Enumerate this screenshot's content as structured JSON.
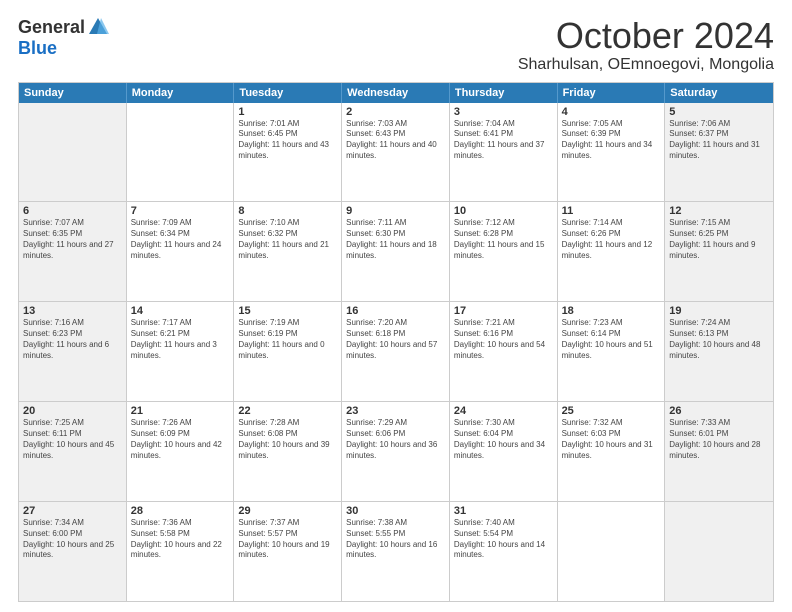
{
  "logo": {
    "general": "General",
    "blue": "Blue"
  },
  "header": {
    "month": "October 2024",
    "location": "Sharhulsan, OEmnoegovi, Mongolia"
  },
  "days": [
    "Sunday",
    "Monday",
    "Tuesday",
    "Wednesday",
    "Thursday",
    "Friday",
    "Saturday"
  ],
  "rows": [
    [
      {
        "day": "",
        "text": ""
      },
      {
        "day": "",
        "text": ""
      },
      {
        "day": "1",
        "text": "Sunrise: 7:01 AM\nSunset: 6:45 PM\nDaylight: 11 hours and 43 minutes."
      },
      {
        "day": "2",
        "text": "Sunrise: 7:03 AM\nSunset: 6:43 PM\nDaylight: 11 hours and 40 minutes."
      },
      {
        "day": "3",
        "text": "Sunrise: 7:04 AM\nSunset: 6:41 PM\nDaylight: 11 hours and 37 minutes."
      },
      {
        "day": "4",
        "text": "Sunrise: 7:05 AM\nSunset: 6:39 PM\nDaylight: 11 hours and 34 minutes."
      },
      {
        "day": "5",
        "text": "Sunrise: 7:06 AM\nSunset: 6:37 PM\nDaylight: 11 hours and 31 minutes."
      }
    ],
    [
      {
        "day": "6",
        "text": "Sunrise: 7:07 AM\nSunset: 6:35 PM\nDaylight: 11 hours and 27 minutes."
      },
      {
        "day": "7",
        "text": "Sunrise: 7:09 AM\nSunset: 6:34 PM\nDaylight: 11 hours and 24 minutes."
      },
      {
        "day": "8",
        "text": "Sunrise: 7:10 AM\nSunset: 6:32 PM\nDaylight: 11 hours and 21 minutes."
      },
      {
        "day": "9",
        "text": "Sunrise: 7:11 AM\nSunset: 6:30 PM\nDaylight: 11 hours and 18 minutes."
      },
      {
        "day": "10",
        "text": "Sunrise: 7:12 AM\nSunset: 6:28 PM\nDaylight: 11 hours and 15 minutes."
      },
      {
        "day": "11",
        "text": "Sunrise: 7:14 AM\nSunset: 6:26 PM\nDaylight: 11 hours and 12 minutes."
      },
      {
        "day": "12",
        "text": "Sunrise: 7:15 AM\nSunset: 6:25 PM\nDaylight: 11 hours and 9 minutes."
      }
    ],
    [
      {
        "day": "13",
        "text": "Sunrise: 7:16 AM\nSunset: 6:23 PM\nDaylight: 11 hours and 6 minutes."
      },
      {
        "day": "14",
        "text": "Sunrise: 7:17 AM\nSunset: 6:21 PM\nDaylight: 11 hours and 3 minutes."
      },
      {
        "day": "15",
        "text": "Sunrise: 7:19 AM\nSunset: 6:19 PM\nDaylight: 11 hours and 0 minutes."
      },
      {
        "day": "16",
        "text": "Sunrise: 7:20 AM\nSunset: 6:18 PM\nDaylight: 10 hours and 57 minutes."
      },
      {
        "day": "17",
        "text": "Sunrise: 7:21 AM\nSunset: 6:16 PM\nDaylight: 10 hours and 54 minutes."
      },
      {
        "day": "18",
        "text": "Sunrise: 7:23 AM\nSunset: 6:14 PM\nDaylight: 10 hours and 51 minutes."
      },
      {
        "day": "19",
        "text": "Sunrise: 7:24 AM\nSunset: 6:13 PM\nDaylight: 10 hours and 48 minutes."
      }
    ],
    [
      {
        "day": "20",
        "text": "Sunrise: 7:25 AM\nSunset: 6:11 PM\nDaylight: 10 hours and 45 minutes."
      },
      {
        "day": "21",
        "text": "Sunrise: 7:26 AM\nSunset: 6:09 PM\nDaylight: 10 hours and 42 minutes."
      },
      {
        "day": "22",
        "text": "Sunrise: 7:28 AM\nSunset: 6:08 PM\nDaylight: 10 hours and 39 minutes."
      },
      {
        "day": "23",
        "text": "Sunrise: 7:29 AM\nSunset: 6:06 PM\nDaylight: 10 hours and 36 minutes."
      },
      {
        "day": "24",
        "text": "Sunrise: 7:30 AM\nSunset: 6:04 PM\nDaylight: 10 hours and 34 minutes."
      },
      {
        "day": "25",
        "text": "Sunrise: 7:32 AM\nSunset: 6:03 PM\nDaylight: 10 hours and 31 minutes."
      },
      {
        "day": "26",
        "text": "Sunrise: 7:33 AM\nSunset: 6:01 PM\nDaylight: 10 hours and 28 minutes."
      }
    ],
    [
      {
        "day": "27",
        "text": "Sunrise: 7:34 AM\nSunset: 6:00 PM\nDaylight: 10 hours and 25 minutes."
      },
      {
        "day": "28",
        "text": "Sunrise: 7:36 AM\nSunset: 5:58 PM\nDaylight: 10 hours and 22 minutes."
      },
      {
        "day": "29",
        "text": "Sunrise: 7:37 AM\nSunset: 5:57 PM\nDaylight: 10 hours and 19 minutes."
      },
      {
        "day": "30",
        "text": "Sunrise: 7:38 AM\nSunset: 5:55 PM\nDaylight: 10 hours and 16 minutes."
      },
      {
        "day": "31",
        "text": "Sunrise: 7:40 AM\nSunset: 5:54 PM\nDaylight: 10 hours and 14 minutes."
      },
      {
        "day": "",
        "text": ""
      },
      {
        "day": "",
        "text": ""
      }
    ]
  ]
}
